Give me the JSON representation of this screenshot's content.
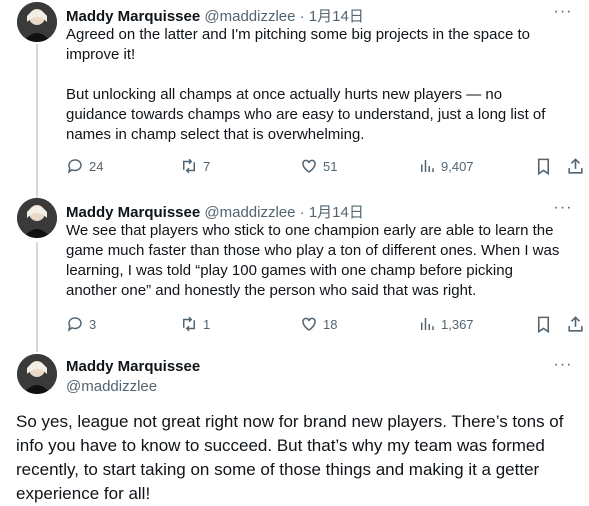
{
  "posts": [
    {
      "name": "Maddy Marquissee",
      "meta": "@maddizzlee · 1月14日",
      "text": "Agreed on the latter and I'm pitching some big projects in the space to improve it!\n\nBut unlocking all champs at once actually hurts new players — no guidance towards champs who are easy to understand, just a long list of names in champ select that is overwhelming.",
      "replies": "24",
      "reposts": "7",
      "likes": "51",
      "views": "9,407"
    },
    {
      "name": "Maddy Marquissee",
      "meta": "@maddizzlee · 1月14日",
      "text": "We see that players who stick to one champion early are able to learn the game much faster than those who play a ton of different ones. When I was learning, I was told “play 100 games with one champ before picking another one” and honestly the person who said that was right.",
      "replies": "3",
      "reposts": "1",
      "likes": "18",
      "views": "1,367"
    }
  ],
  "main_post": {
    "name": "Maddy Marquissee",
    "handle": "@maddizzlee",
    "text": "So yes, league not great right now for brand new players. There’s tons of info you have to know to succeed. But that’s why my team was formed recently, to start taking on some of those things and making it a getter experience for all!"
  },
  "icons": {
    "more": "more-icon",
    "reply": "reply-icon",
    "repost": "repost-icon",
    "like": "heart-icon",
    "views": "views-chart-icon",
    "bookmark": "bookmark-icon",
    "share": "share-icon"
  },
  "colors": {
    "text": "#0f1419",
    "secondary": "#536471",
    "thread_line": "#cfd9de"
  }
}
